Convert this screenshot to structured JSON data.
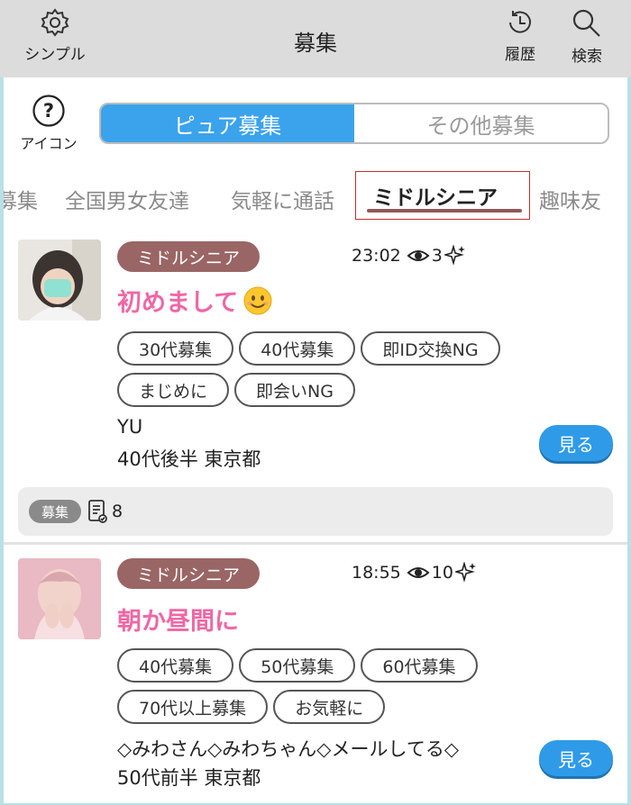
{
  "header": {
    "title": "募集",
    "simple_label": "シンプル",
    "history_label": "履歴",
    "search_label": "検索"
  },
  "toggle": {
    "label": "アイコン"
  },
  "tabs": [
    {
      "label": "ピュア募集",
      "active": true
    },
    {
      "label": "その他募集",
      "active": false
    }
  ],
  "categories": [
    {
      "label": "募集"
    },
    {
      "label": "全国男女友達"
    },
    {
      "label": "気軽に通話"
    },
    {
      "label": "ミドルシニア",
      "active": true
    },
    {
      "label": "趣味友"
    }
  ],
  "posts": [
    {
      "category": "ミドルシニア",
      "time": "23:02",
      "views": "3",
      "title": "初めまして",
      "tags": [
        "30代募集",
        "40代募集",
        "即ID交換NG",
        "まじめに",
        "即会いNG"
      ],
      "name": "YU",
      "info": "40代後半 東京都",
      "button": "見る",
      "footer_chip": "募集",
      "footer_count": "8"
    },
    {
      "category": "ミドルシニア",
      "time": "18:55",
      "views": "10",
      "title": "朝か昼間に",
      "tags": [
        "40代募集",
        "50代募集",
        "60代募集",
        "70代以上募集",
        "お気軽に"
      ],
      "name": "◇みわさん◇みわちゃん◇メールしてる◇",
      "info": "50代前半 東京都",
      "button": "見る"
    }
  ],
  "colors": {
    "accent": "#3aa3ec",
    "badge": "#9a6565",
    "title_pink": "#ef67a5",
    "header_bg": "#dcdcdc"
  }
}
